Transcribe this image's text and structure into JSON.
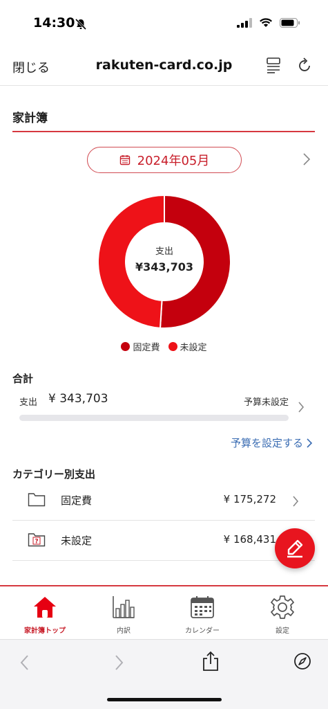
{
  "status": {
    "time": "14:30"
  },
  "browser": {
    "close_label": "閉じる",
    "url": "rakuten-card.co.jp"
  },
  "page": {
    "title": "家計簿",
    "month": "2024年05月"
  },
  "donut": {
    "label": "支出",
    "value": "¥343,703",
    "segments": [
      {
        "name": "固定費",
        "amount": 175272,
        "color": "#c4000d"
      },
      {
        "name": "未設定",
        "amount": 168431,
        "color": "#ee1218"
      }
    ]
  },
  "legend": [
    {
      "label": "固定費",
      "color": "#c4000d"
    },
    {
      "label": "未設定",
      "color": "#ee1218"
    }
  ],
  "total": {
    "heading": "合計",
    "label": "支出",
    "value": "¥ 343,703",
    "budget_status": "予算未設定",
    "progress": 0
  },
  "set_budget_label": "予算を設定する",
  "categories": {
    "heading": "カテゴリー別支出",
    "items": [
      {
        "name": "固定費",
        "amount": "¥ 175,272",
        "icon": "folder-icon"
      },
      {
        "name": "未設定",
        "amount": "¥ 168,431",
        "icon": "folder-question-icon"
      }
    ]
  },
  "tabs": [
    {
      "label": "家計簿トップ",
      "icon": "home-icon",
      "active": true
    },
    {
      "label": "内訳",
      "icon": "bar-chart-icon",
      "active": false
    },
    {
      "label": "カレンダー",
      "icon": "calendar-icon",
      "active": false
    },
    {
      "label": "設定",
      "icon": "gear-icon",
      "active": false
    }
  ],
  "colors": {
    "accent": "#c81e2a",
    "link": "#3b6db3",
    "fab": "#e8151f"
  }
}
